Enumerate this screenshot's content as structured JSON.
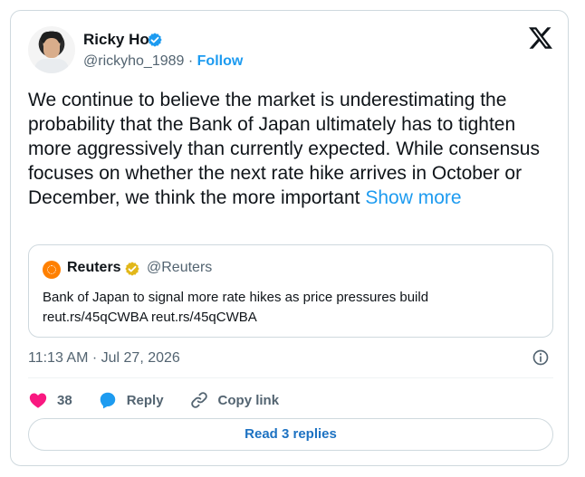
{
  "author": {
    "name": "Ricky Ho",
    "handle": "@rickyho_1989",
    "separator": " · ",
    "follow_label": "Follow",
    "verified_icon": "verified-badge-icon",
    "avatar": "profile-photo"
  },
  "platform_icon": "x-logo-icon",
  "tweet": {
    "text": "We continue to believe the market is underestimating the probability that the Bank of Japan ultimately has to tighten more aggressively than currently expected. While consensus focuses on whether the next rate hike arrives in October or December, we think the more important",
    "show_more_label": "Show more",
    "timestamp": "11:13 AM · Jul 27, 2026"
  },
  "quoted": {
    "name": "Reuters",
    "handle": "@Reuters",
    "text": "Bank of Japan to signal more rate hikes as price pressures build",
    "link": "reut.rs/45qCWBA reut.rs/45qCWBA"
  },
  "actions": {
    "likes": "38",
    "reply_label": "Reply",
    "copy_link_label": "Copy link",
    "read_replies_label": "Read 3 replies"
  },
  "colors": {
    "accent": "#1d9bf0",
    "like": "#f91880",
    "text": "#0f1419",
    "muted": "#536471",
    "border": "#cfd9de",
    "reuters_orange": "#ff8000",
    "gold_badge": "#e2b719"
  }
}
